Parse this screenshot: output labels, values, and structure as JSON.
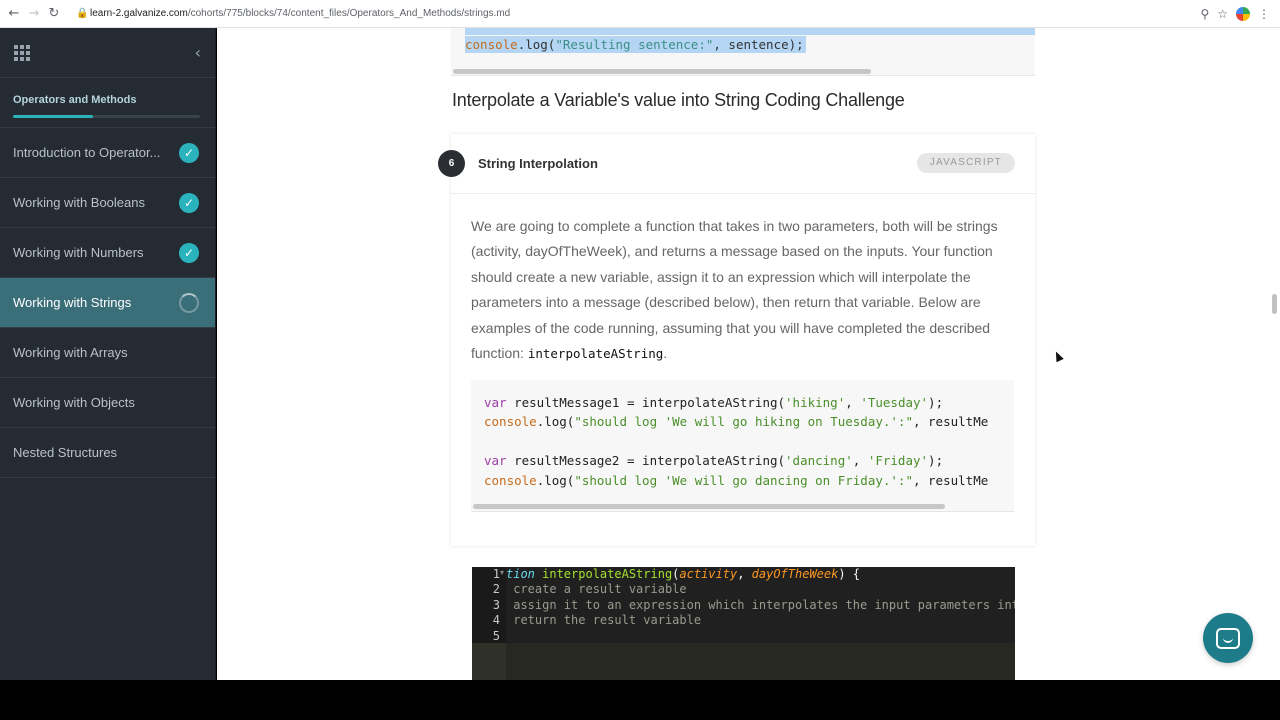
{
  "browser": {
    "url_host": "learn-2.galvanize.com",
    "url_path": "/cohorts/775/blocks/74/content_files/Operators_And_Methods/strings.md",
    "back_icon": "arrow-left-icon",
    "forward_icon": "arrow-right-icon",
    "reload_icon": "reload-icon",
    "zoom_icon": "zoom-icon",
    "bookmark_icon": "star-icon",
    "menu_icon": "kebab-menu-icon"
  },
  "sidebar": {
    "section_title": "Operators and Methods",
    "progress_fraction": 0.43,
    "items": [
      {
        "label": "Introduction to Operator...",
        "status": "complete"
      },
      {
        "label": "Working with Booleans",
        "status": "complete"
      },
      {
        "label": "Working with Numbers",
        "status": "complete"
      },
      {
        "label": "Working with Strings",
        "status": "in-progress"
      },
      {
        "label": "Working with Arrays",
        "status": "none"
      },
      {
        "label": "Working with Objects",
        "status": "none"
      },
      {
        "label": "Nested Structures",
        "status": "none"
      }
    ]
  },
  "previous_code": {
    "line": "console.log(\"Resulting sentence:\", sentence);",
    "keyword": "console",
    "rest_a": ".log(",
    "string": "\"Resulting sentence:\"",
    "rest_b": ", sentence);"
  },
  "main": {
    "heading": "Interpolate a Variable's value into String Coding Challenge",
    "challenge": {
      "number": "6",
      "title": "String Interpolation",
      "language": "JAVASCRIPT",
      "description": "We are going to complete a function that takes in two parameters, both will be strings (activity, dayOfTheWeek), and returns a message based on the inputs. Your function should create a new variable, assign it to an expression which will interpolate the parameters into a message (described below), then return that variable. Below are examples of the code running, assuming that you will have completed the described function: ",
      "function_name": "interpolateAString",
      "description_end": "."
    }
  },
  "example_code": {
    "l1": {
      "kw": "var",
      "a": " resultMessage1 = interpolateAString(",
      "s1": "'hiking'",
      "b": ", ",
      "s2": "'Tuesday'",
      "c": ");"
    },
    "l2": {
      "kw": "console",
      "a": ".log(",
      "s": "\"should log 'We will go hiking on Tuesday.':\"",
      "b": ", resultMe"
    },
    "l3": {
      "kw": "var",
      "a": " resultMessage2 = interpolateAString(",
      "s1": "'dancing'",
      "b": ", ",
      "s2": "'Friday'",
      "c": ");"
    },
    "l4": {
      "kw": "console",
      "a": ".log(",
      "s": "\"should log 'We will go dancing on Friday.':\"",
      "b": ", resultMe"
    }
  },
  "editor": {
    "line_numbers": [
      "1",
      "2",
      "3",
      "4",
      "5"
    ],
    "line1": {
      "kw": "tion ",
      "fn": "interpolateAString",
      "p0": "(",
      "param1": "activity",
      "comma": ", ",
      "param2": "dayOfTheWeek",
      "p1": ") {"
    },
    "line2": " create a result variable",
    "line3": " assign it to an expression which interpolates the input parameters into",
    "line4": " return the result variable"
  },
  "chat": {
    "icon": "chat-icon"
  }
}
